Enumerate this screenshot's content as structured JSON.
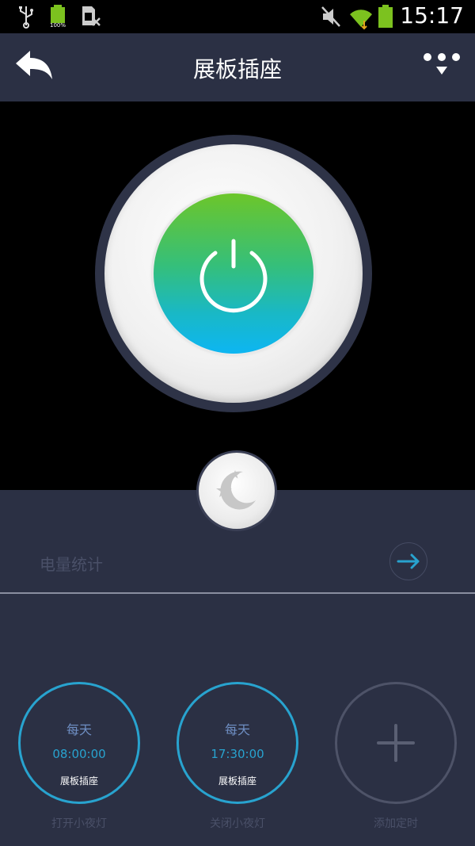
{
  "status_bar": {
    "time": "15:17",
    "battery_label": "100%",
    "icons": [
      "usb-icon",
      "battery-icon",
      "sim-off-icon",
      "mute-icon",
      "wifi-icon",
      "battery-icon"
    ]
  },
  "app_bar": {
    "title": "展板插座",
    "back_icon": "back-arrow-icon",
    "more_icon": "more-options-icon"
  },
  "power": {
    "state": "on",
    "icon": "power-icon",
    "gradient": [
      "#6cc62a",
      "#0db6f2"
    ]
  },
  "night_light": {
    "icon": "moon-stars-icon"
  },
  "stats": {
    "label": "电量统计",
    "arrow_icon": "arrow-right-icon"
  },
  "timers": [
    {
      "day": "每天",
      "time": "08:00:00",
      "device": "展板插座",
      "caption": "打开小夜灯"
    },
    {
      "day": "每天",
      "time": "17:30:00",
      "device": "展板插座",
      "caption": "关闭小夜灯"
    }
  ],
  "add_timer": {
    "caption": "添加定时",
    "icon": "plus-icon"
  },
  "colors": {
    "background": "#2b3044",
    "accent": "#28a3cf",
    "muted": "#4a5068"
  }
}
